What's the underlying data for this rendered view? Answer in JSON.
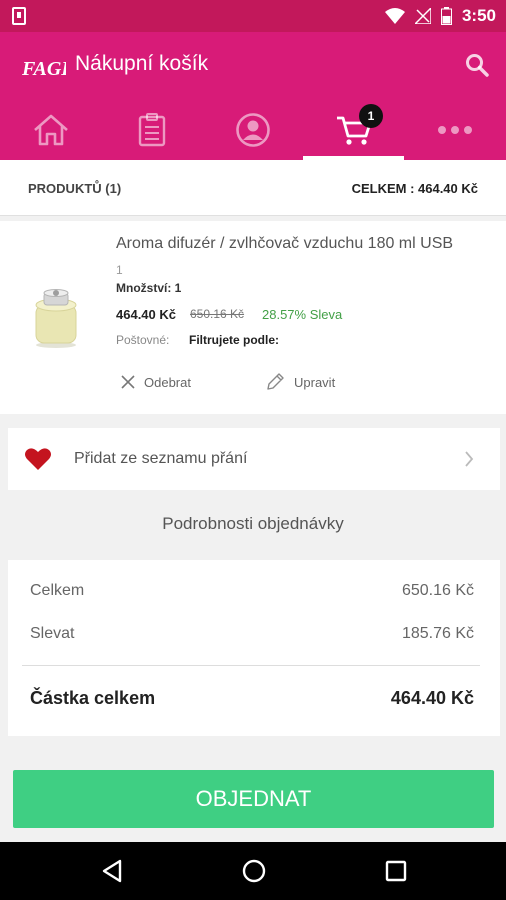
{
  "status_bar": {
    "time": "3:50"
  },
  "app_bar": {
    "title": "Nákupní košík",
    "logo_text": "FAGER"
  },
  "tabs": [
    {
      "name": "home-icon"
    },
    {
      "name": "clipboard-icon"
    },
    {
      "name": "user-icon"
    },
    {
      "name": "cart-icon",
      "badge": "1",
      "active": true
    },
    {
      "name": "more-icon"
    }
  ],
  "summary": {
    "products_label": "PRODUKTŮ (1)",
    "total_label": "CELKEM : 464.40 Kč"
  },
  "product": {
    "name": "Aroma difuzér / zvlhčovač vzduchu 180 ml USB",
    "variant": "1",
    "quantity": "Množství: 1",
    "price": "464.40 Kč",
    "old_price": "650.16 Kč",
    "discount": "28.57% Sleva",
    "shipping_label": "Poštovné:",
    "shipping_value": "Filtrujete podle:",
    "remove_label": "Odebrat",
    "edit_label": "Upravit"
  },
  "wishlist": {
    "label": "Přidat ze seznamu přání"
  },
  "order_details": {
    "title": "Podrobnosti objednávky",
    "subtotal_label": "Celkem",
    "subtotal_value": "650.16 Kč",
    "discount_label": "Slevat",
    "discount_value": "185.76 Kč",
    "total_label": "Částka celkem",
    "total_value": "464.40 Kč"
  },
  "order_button": "OBJEDNAT",
  "colors": {
    "primary": "#d81b78",
    "status": "#c2185b",
    "accent_green": "#3fcf83",
    "discount_green": "#43a047"
  }
}
